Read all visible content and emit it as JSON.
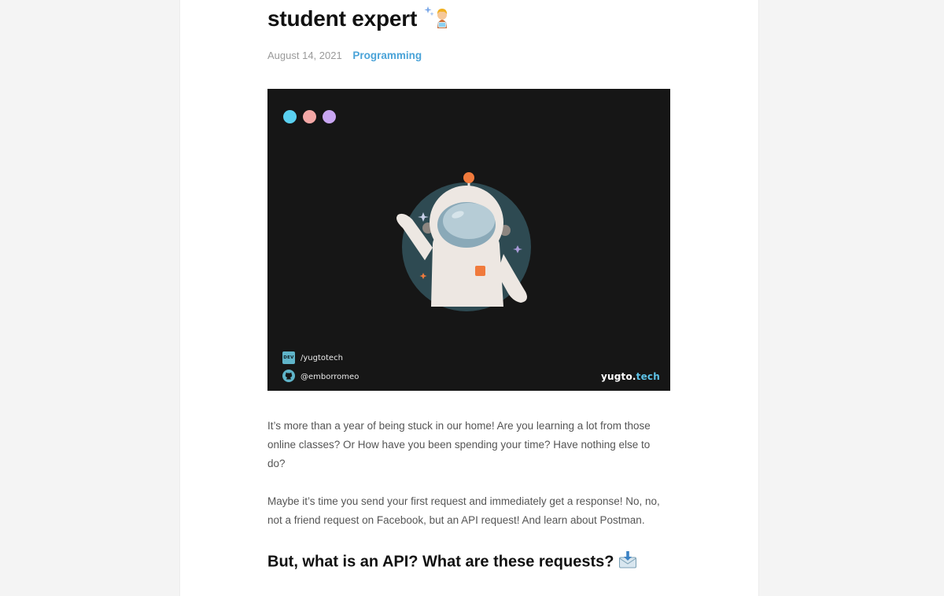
{
  "post": {
    "title": "student expert",
    "date": "August 14, 2021",
    "category": "Programming"
  },
  "hero": {
    "dev_badge": "DEV",
    "dev_handle": "/yugtotech",
    "github_handle": "@emborromeo",
    "brand_name": "yugto.",
    "brand_tld": "tech",
    "colors": {
      "background": "#161616",
      "dot1": "#5ad0f0",
      "dot2": "#f4a8a6",
      "dot3": "#c9a6f2",
      "planet": "#2e4a52",
      "accent": "#f07a3c"
    }
  },
  "body": {
    "paragraph1": "It’s more than a year of being stuck in our home! Are you learning a lot from those online classes? Or How have you been spending your time? Have nothing else to do?",
    "paragraph2": "Maybe it’s time you send your first request and immediately get a response! No, no, not a friend request on Facebook, but an API request! And learn about Postman.",
    "heading": "But, what is an API? What are these requests?"
  },
  "icons": {
    "title_emoji": "student-emoji-icon",
    "heading_emoji": "envelope-download-icon"
  }
}
